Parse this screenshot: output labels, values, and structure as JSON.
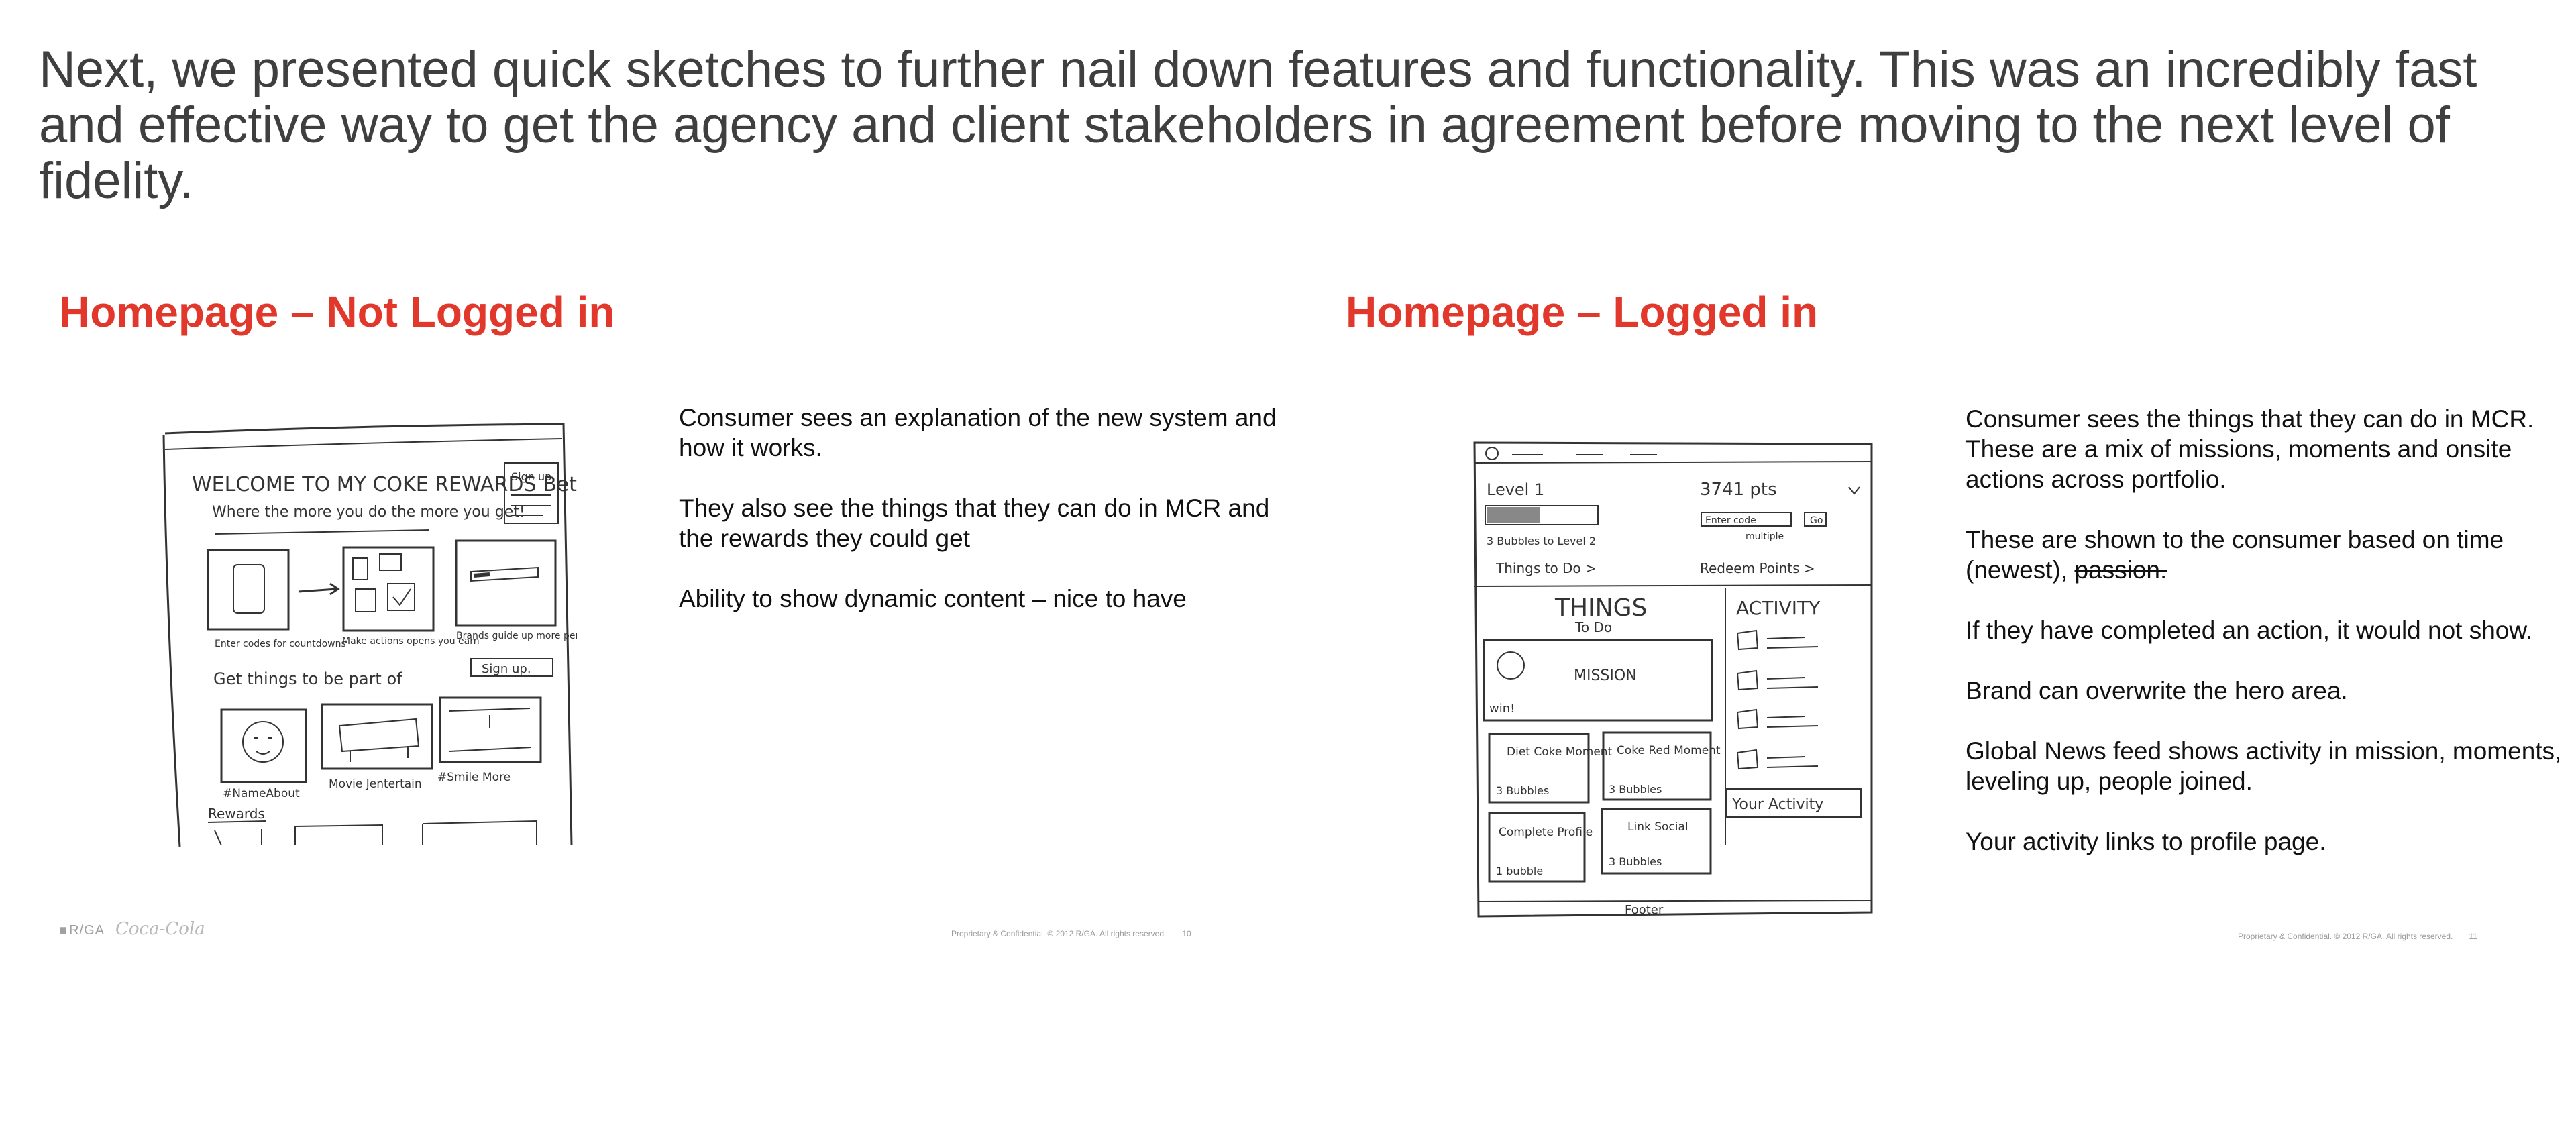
{
  "intro": "Next, we presented quick sketches to further nail down features and functionality. This was an incredibly fast and effective way to get the agency and client stakeholders in agreement before moving to the next level of fidelity.",
  "left_slide": {
    "title": "Homepage – Not Logged in",
    "paragraphs": [
      "Consumer sees an explanation of the new system and how it works.",
      "They also see the things that they can do in MCR and the rewards they could get",
      "Ability to show dynamic content – nice to have"
    ],
    "sketch": {
      "heading": "WELCOME TO MY COKE REWARDS Beta.",
      "subheading": "Where the more you do the more you get!",
      "signup": "Sign up",
      "step_captions": [
        "Enter codes for countdowns",
        "Make actions opens you earn",
        "Brands guide up more perks + prizes"
      ],
      "signup_button": "Sign up.",
      "things_label": "Get things to be part of",
      "tile_captions": [
        "#NameAbout",
        "Movie Jentertain",
        "#Smile More"
      ],
      "rewards_label": "Rewards"
    },
    "footer": "Proprietary & Confidential. © 2012 R/GA. All rights reserved.",
    "page_number": "10",
    "logo_rga": "R/GA",
    "logo_coke": "Coca-Cola"
  },
  "right_slide": {
    "title": "Homepage – Logged in",
    "paragraphs": [
      "Consumer sees the things that they can do in MCR. These are a mix of missions, moments and onsite actions across portfolio.",
      "If they have completed an action, it would not show.",
      "Brand can overwrite the hero area.",
      "Global News feed shows activity in mission, moments, leveling up, people joined.",
      "Your activity links to profile page."
    ],
    "time_sentence": "These are shown to the consumer based on time (newest),",
    "struck_word": "passion.",
    "sketch": {
      "level": "Level 1",
      "points": "3741 pts",
      "bubbles_to_level": "3 Bubbles to Level 2",
      "enter_code": "Enter code",
      "go": "Go",
      "multiple": "multiple",
      "things_to_do": "Things to Do >",
      "redeem": "Redeem Points >",
      "things_heading": "THINGS",
      "to_do": "To Do",
      "win": "win!",
      "mission": "MISSION",
      "activity_heading": "ACTIVITY",
      "your_activity": "Your Activity",
      "tiles": [
        {
          "title": "Diet Coke Moment",
          "sub": "3 Bubbles"
        },
        {
          "title": "Coke Red Moment",
          "sub": "3 Bubbles"
        },
        {
          "title": "Complete Profile",
          "sub": "1 bubble"
        },
        {
          "title": "Link Social",
          "sub": "3 Bubbles"
        }
      ],
      "footer": "Footer"
    },
    "footer": "Proprietary & Confidential. © 2012 R/GA. All rights reserved.",
    "page_number": "11"
  }
}
